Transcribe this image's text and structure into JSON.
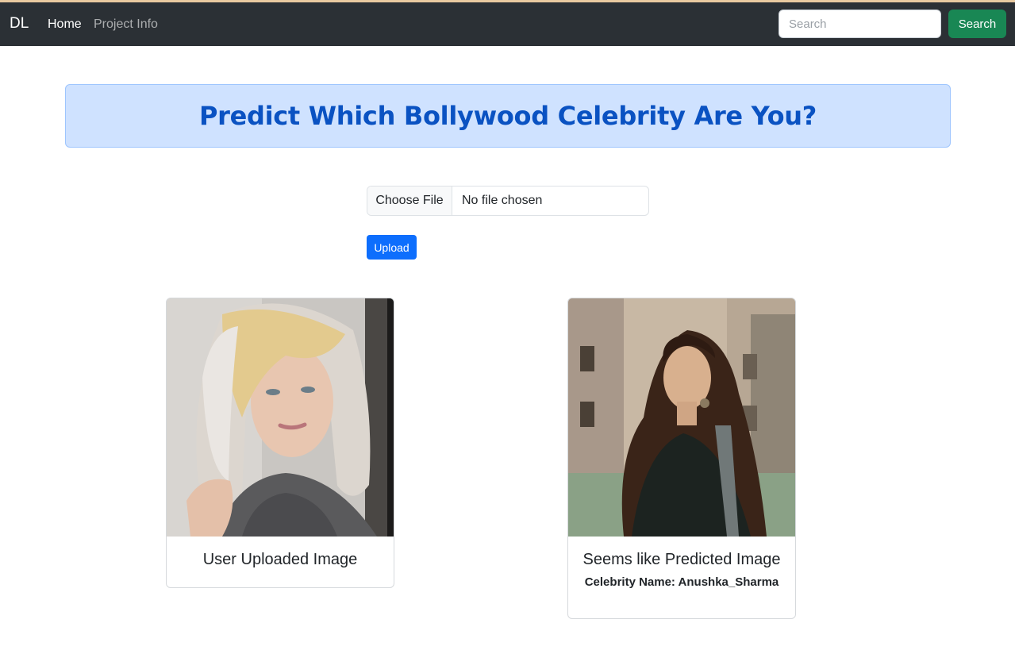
{
  "navbar": {
    "brand": "DL",
    "links": [
      {
        "label": "Home"
      },
      {
        "label": "Project Info"
      }
    ],
    "search": {
      "placeholder": "Search",
      "button_label": "Search"
    }
  },
  "alert": {
    "title": "Predict Which Bollywood Celebrity Are You?"
  },
  "upload": {
    "choose_label": "Choose File",
    "file_status": "No file chosen",
    "button_label": "Upload"
  },
  "cards": {
    "user": {
      "title": "User Uploaded Image"
    },
    "predicted": {
      "title": "Seems like Predicted Image",
      "celebrity": "Celebrity Name: Anushka_Sharma"
    }
  },
  "colors": {
    "navbar": "#2b3035",
    "alert_bg": "#cfe2ff",
    "alert_text": "#0a52c2",
    "search_btn": "#198754",
    "upload_btn": "#0d6efd"
  }
}
